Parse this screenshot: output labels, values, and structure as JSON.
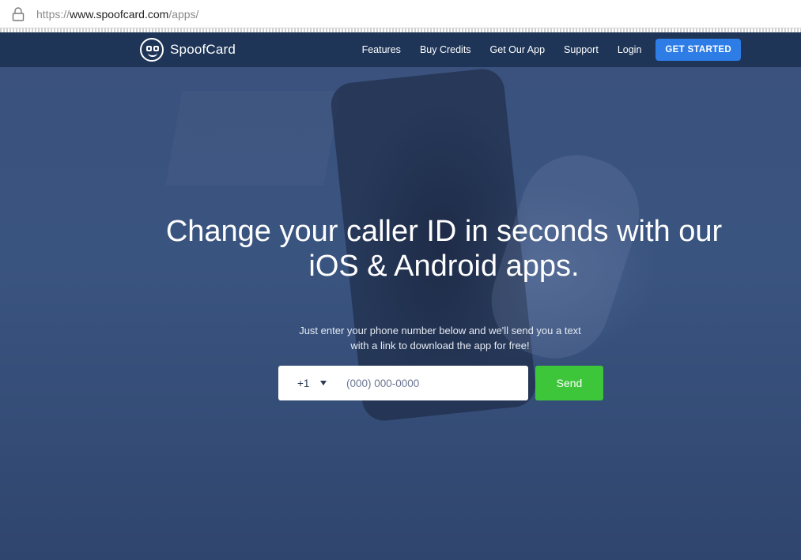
{
  "browser": {
    "url_prefix": "https://",
    "url_host": "www.spoofcard.com",
    "url_path": "/apps/"
  },
  "nav": {
    "brand": "SpoofCard",
    "links": [
      "Features",
      "Buy Credits",
      "Get Our App",
      "Support",
      "Login"
    ],
    "cta": "GET STARTED"
  },
  "hero": {
    "headline_line1": "Change your caller ID in seconds with our",
    "headline_line2": "iOS & Android apps.",
    "subtext_line1": "Just enter your phone number below and we'll send you a text",
    "subtext_line2": "with a link to download the app for free!",
    "country_code": "+1",
    "phone_placeholder": "(000) 000-0000",
    "send_label": "Send"
  },
  "colors": {
    "nav_bg": "#1e3557",
    "cta_bg": "#2e7ce6",
    "send_bg": "#3ec63b",
    "hero_bg": "#3a527d"
  },
  "icons": {
    "lock": "lock-icon",
    "logo": "spoofcard-logo-icon",
    "caret": "caret-down-icon"
  }
}
